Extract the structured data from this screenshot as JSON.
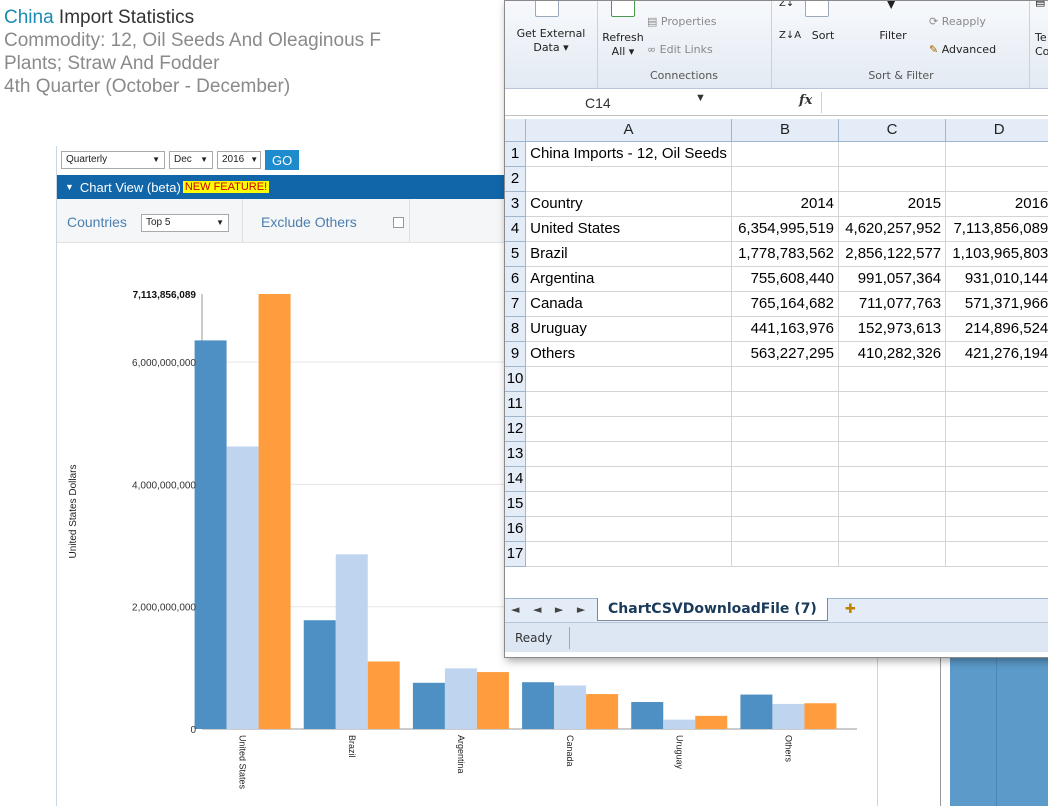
{
  "page": {
    "heading": {
      "country": "China",
      "title_rest": " Import Statistics",
      "commodity": "Commodity: 12, Oil Seeds And Oleaginous F",
      "commodity_cont": "Plants; Straw And Fodder",
      "period": "4th Quarter (October - December)"
    },
    "controls": {
      "frequency": "Quarterly",
      "month": "Dec",
      "year": "2016",
      "go_label": "GO"
    },
    "chart_view": {
      "label": "Chart View (beta)",
      "badge": "NEW FEATURE!"
    },
    "filters": {
      "countries_label": "Countries",
      "countries_value": "Top 5",
      "exclude_label": "Exclude Others"
    }
  },
  "chart_data": {
    "type": "bar",
    "categories": [
      "United States",
      "Brazil",
      "Argentina",
      "Canada",
      "Uruguay",
      "Others"
    ],
    "series": [
      {
        "values": [
          6354995519,
          1778783562,
          755608440,
          765164682,
          441163976,
          563227295
        ],
        "color": "#4f90c4"
      },
      {
        "values": [
          4620257952,
          2856122577,
          991057364,
          711077763,
          152973613,
          410282326
        ],
        "color": "#bfd4ee"
      },
      {
        "values": [
          7113856089,
          1103965803,
          931010144,
          571371966,
          214896524,
          421276194
        ],
        "color": "#ff9d3e"
      }
    ],
    "ylabel": "United States Dollars",
    "y_ticks": [
      "0",
      "2,000,000,000",
      "4,000,000,000",
      "6,000,000,000"
    ],
    "y_max_label": "7,113,856,089",
    "ylim": [
      0,
      7113856089
    ]
  },
  "excel": {
    "ribbon": {
      "get_external_data": "Get External",
      "get_external_data2": "Data ▾",
      "refresh_all": "Refresh",
      "refresh_all2": "All ▾",
      "properties": "Properties",
      "edit_links": "Edit Links",
      "connections_group": "Connections",
      "sort": "Sort",
      "filter": "Filter",
      "reapply": "Reapply",
      "advanced": "Advanced",
      "sort_filter_group": "Sort & Filter",
      "text_to_columns_partial": "Te",
      "text_to_columns_partial2": "Co"
    },
    "name_box": "C14",
    "fx": "fx",
    "columns": [
      "A",
      "B",
      "C",
      "D"
    ],
    "rows": [
      {
        "n": "1",
        "a": "China Imports - 12, Oil Seeds",
        "b": "",
        "c": "",
        "d": ""
      },
      {
        "n": "2",
        "a": "",
        "b": "",
        "c": "",
        "d": ""
      },
      {
        "n": "3",
        "a": "Country",
        "b": "2014",
        "c": "2015",
        "d": "2016"
      },
      {
        "n": "4",
        "a": "United States",
        "b": "6,354,995,519",
        "c": "4,620,257,952",
        "d": "7,113,856,089"
      },
      {
        "n": "5",
        "a": "Brazil",
        "b": "1,778,783,562",
        "c": "2,856,122,577",
        "d": "1,103,965,803"
      },
      {
        "n": "6",
        "a": "Argentina",
        "b": "755,608,440",
        "c": "991,057,364",
        "d": "931,010,144"
      },
      {
        "n": "7",
        "a": "Canada",
        "b": "765,164,682",
        "c": "711,077,763",
        "d": "571,371,966"
      },
      {
        "n": "8",
        "a": "Uruguay",
        "b": "441,163,976",
        "c": "152,973,613",
        "d": "214,896,524"
      },
      {
        "n": "9",
        "a": "Others",
        "b": "563,227,295",
        "c": "410,282,326",
        "d": "421,276,194"
      },
      {
        "n": "10",
        "a": "",
        "b": "",
        "c": "",
        "d": ""
      },
      {
        "n": "11",
        "a": "",
        "b": "",
        "c": "",
        "d": ""
      },
      {
        "n": "12",
        "a": "",
        "b": "",
        "c": "",
        "d": ""
      },
      {
        "n": "13",
        "a": "",
        "b": "",
        "c": "",
        "d": ""
      },
      {
        "n": "14",
        "a": "",
        "b": "",
        "c": "",
        "d": ""
      },
      {
        "n": "15",
        "a": "",
        "b": "",
        "c": "",
        "d": ""
      },
      {
        "n": "16",
        "a": "",
        "b": "",
        "c": "",
        "d": ""
      },
      {
        "n": "17",
        "a": "",
        "b": "",
        "c": "",
        "d": ""
      }
    ],
    "sheet_tab": "ChartCSVDownloadFile (7)",
    "tab_nav": "◄ ◄ ► ►",
    "status": "Ready"
  }
}
